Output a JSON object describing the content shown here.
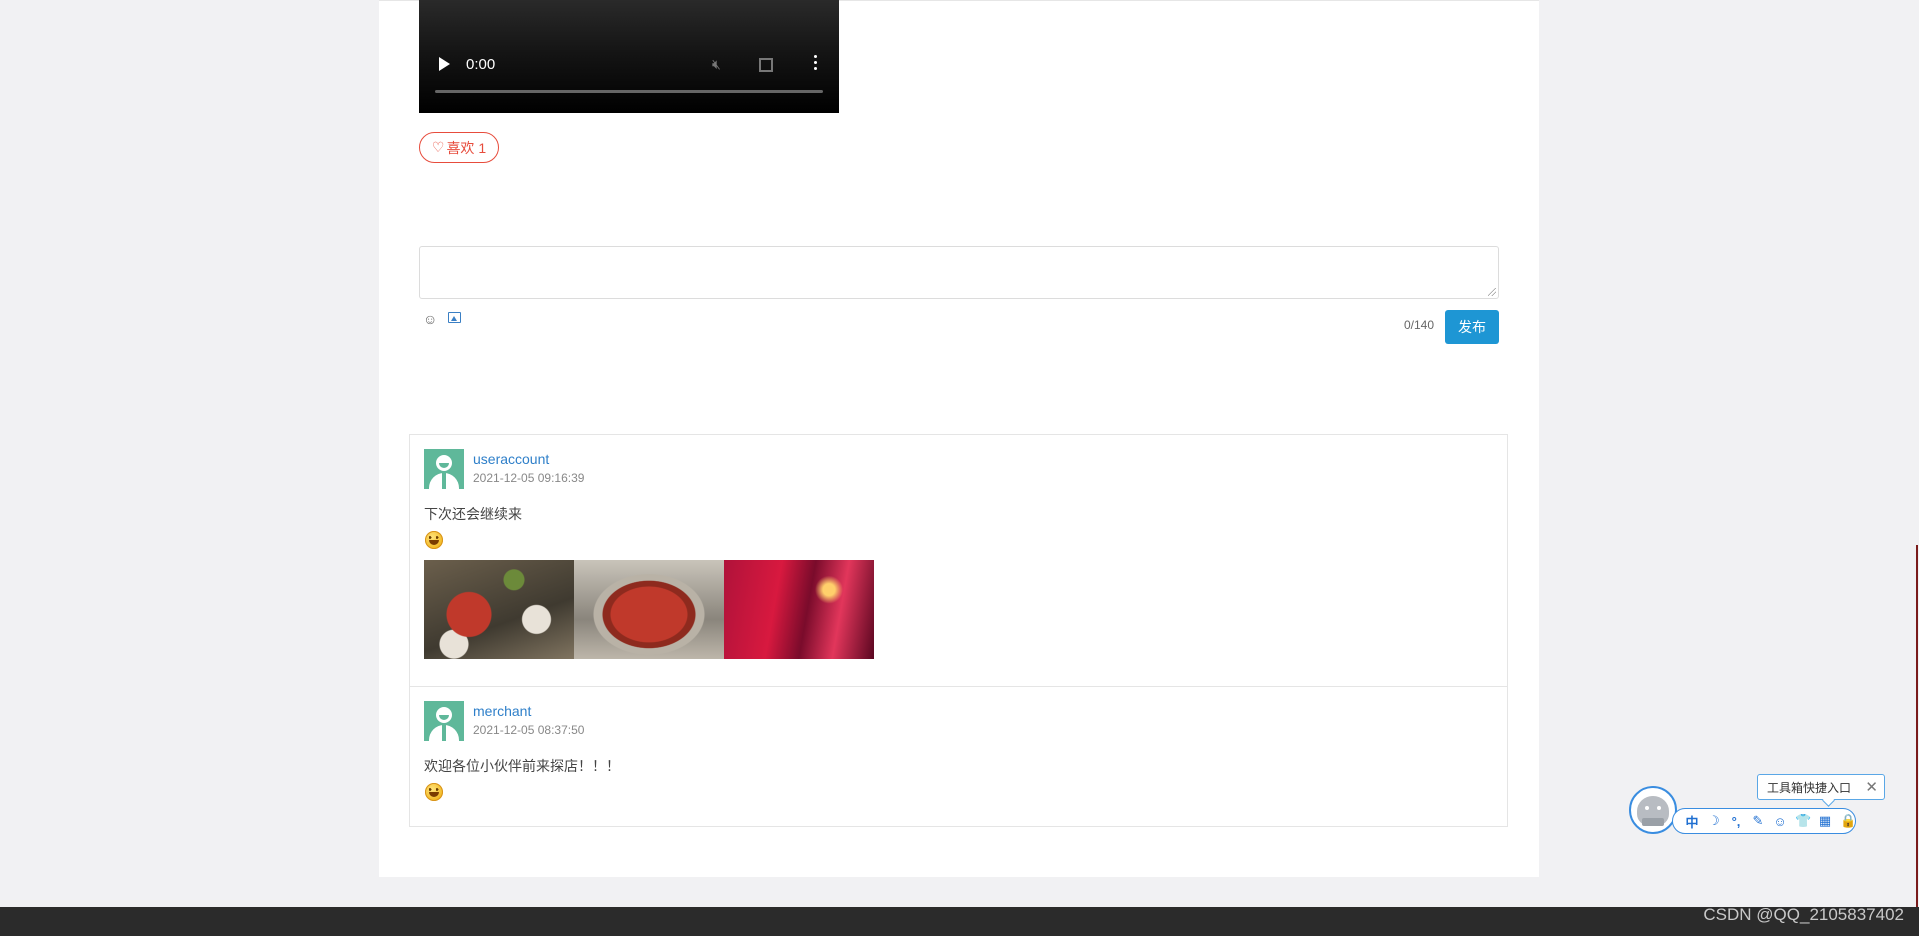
{
  "video": {
    "time": "0:00"
  },
  "like": {
    "label": "喜欢 1"
  },
  "composer": {
    "placeholder": "",
    "counter": "0/140",
    "publish_label": "发布"
  },
  "comments": [
    {
      "username": "useraccount",
      "timestamp": "2021-12-05 09:16:39",
      "text": "下次还会继续来",
      "emoji": "grinning-emoji",
      "photo_count": 3
    },
    {
      "username": "merchant",
      "timestamp": "2021-12-05 08:37:50",
      "text": "欢迎各位小伙伴前来探店！！！",
      "emoji": "grinning-emoji"
    }
  ],
  "toolbox": {
    "tooltip": "工具箱快捷入口",
    "items": [
      "中",
      "☽",
      "°,",
      "✎",
      "☺",
      "👕",
      "▦",
      "🔒"
    ]
  },
  "watermark": "CSDN @QQ_2105837402",
  "colors": {
    "accent": "#1e96d4",
    "like": "#e74c3c",
    "username": "#2e7fc9",
    "footer": "#2b2b2b"
  }
}
